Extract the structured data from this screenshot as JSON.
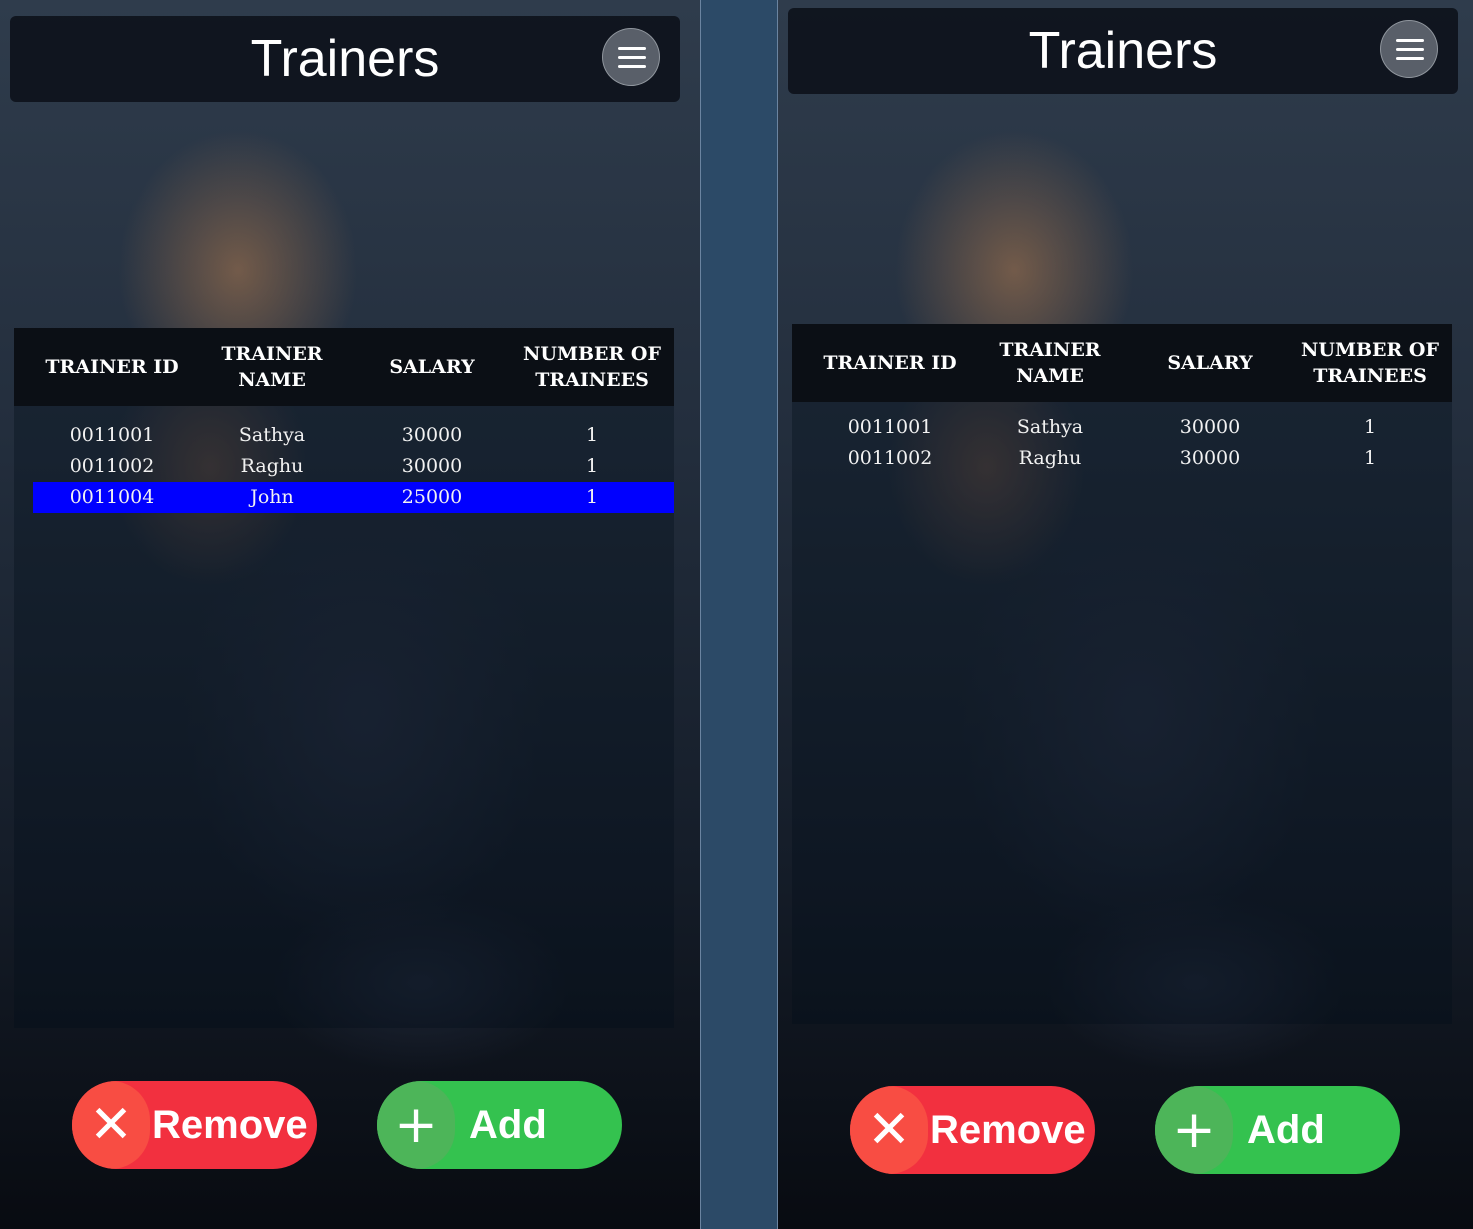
{
  "screens": [
    {
      "title": "Trainers",
      "columns": [
        "TRAINER ID",
        "TRAINER NAME",
        "SALARY",
        "NUMBER OF TRAINEES"
      ],
      "rows": [
        {
          "id": "0011001",
          "name": "Sathya",
          "salary": "30000",
          "trainees": "1",
          "selected": false
        },
        {
          "id": "0011002",
          "name": "Raghu",
          "salary": "30000",
          "trainees": "1",
          "selected": false
        },
        {
          "id": "0011004",
          "name": "John",
          "salary": "25000",
          "trainees": "1",
          "selected": true
        }
      ],
      "remove_label": "Remove",
      "add_label": "Add"
    },
    {
      "title": "Trainers",
      "columns": [
        "TRAINER ID",
        "TRAINER NAME",
        "SALARY",
        "NUMBER OF TRAINEES"
      ],
      "rows": [
        {
          "id": "0011001",
          "name": "Sathya",
          "salary": "30000",
          "trainees": "1",
          "selected": false
        },
        {
          "id": "0011002",
          "name": "Raghu",
          "salary": "30000",
          "trainees": "1",
          "selected": false
        }
      ],
      "remove_label": "Remove",
      "add_label": "Add"
    }
  ],
  "icons": {
    "menu": "hamburger-menu-icon",
    "remove": "close-x-icon",
    "add": "plus-icon"
  },
  "colors": {
    "selected_row": "#0000ff",
    "remove_button": "#f2303f",
    "add_button": "#34c24f",
    "divider": "#2c4a67"
  }
}
